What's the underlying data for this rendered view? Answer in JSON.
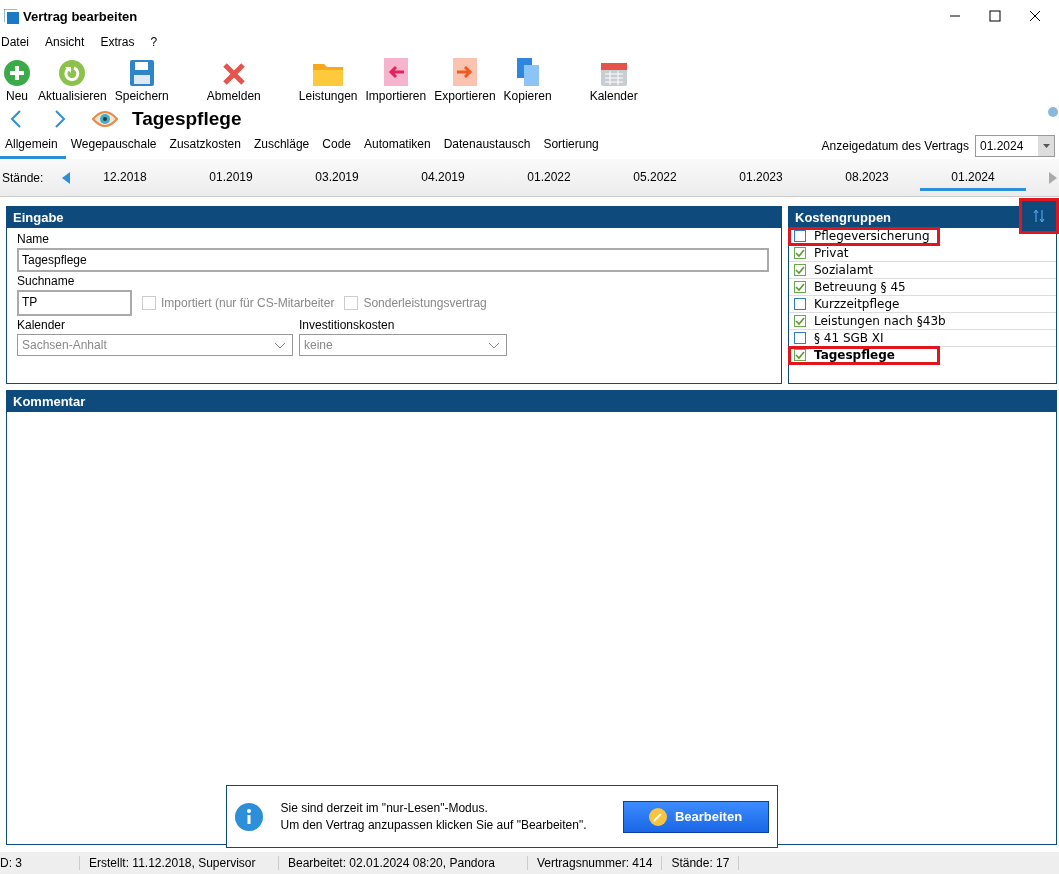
{
  "window": {
    "title": "Vertrag bearbeiten"
  },
  "menu": [
    "Datei",
    "Ansicht",
    "Extras",
    "?"
  ],
  "toolbar": [
    {
      "label": "Neu",
      "kind": "new"
    },
    {
      "label": "Aktualisieren",
      "kind": "refresh"
    },
    {
      "label": "Speichern",
      "kind": "save"
    },
    {
      "label": "Abmelden",
      "kind": "logout"
    },
    {
      "label": "Leistungen",
      "kind": "folder"
    },
    {
      "label": "Importieren",
      "kind": "import"
    },
    {
      "label": "Exportieren",
      "kind": "export"
    },
    {
      "label": "Kopieren",
      "kind": "copy"
    },
    {
      "label": "Kalender",
      "kind": "calendar"
    }
  ],
  "header": {
    "title": "Tagespflege"
  },
  "tabs": [
    {
      "label": "Allgemein",
      "selected": true
    },
    {
      "label": "Wegepauschale",
      "selected": false
    },
    {
      "label": "Zusatzkosten",
      "selected": false
    },
    {
      "label": "Zuschläge",
      "selected": false
    },
    {
      "label": "Code",
      "selected": false
    },
    {
      "label": "Automatiken",
      "selected": false
    },
    {
      "label": "Datenaustausch",
      "selected": false
    },
    {
      "label": "Sortierung",
      "selected": false
    }
  ],
  "display_date": {
    "label": "Anzeigedatum des Vertrags",
    "value": "01.2024"
  },
  "versions": {
    "label": "Stände:",
    "items": [
      {
        "label": "12.2018",
        "selected": false
      },
      {
        "label": "01.2019",
        "selected": false
      },
      {
        "label": "03.2019",
        "selected": false
      },
      {
        "label": "04.2019",
        "selected": false
      },
      {
        "label": "01.2022",
        "selected": false
      },
      {
        "label": "05.2022",
        "selected": false
      },
      {
        "label": "01.2023",
        "selected": false
      },
      {
        "label": "08.2023",
        "selected": false
      },
      {
        "label": "01.2024",
        "selected": true
      }
    ]
  },
  "input_panel": {
    "title": "Eingabe",
    "name_label": "Name",
    "name_value": "Tagespflege",
    "search_label": "Suchname",
    "search_value": "TP",
    "checkboxes": [
      {
        "label": "Importiert (nur für CS-Mitarbeiter",
        "checked": false,
        "disabled": true
      },
      {
        "label": "Sonderleistungsvertrag",
        "checked": false,
        "disabled": true
      }
    ],
    "calendar_label": "Kalender",
    "calendar_value": "Sachsen-Anhalt",
    "invest_label": "Investitionskosten",
    "invest_value": "keine"
  },
  "cost_groups": {
    "title": "Kostengruppen",
    "sort_highlighted": true,
    "items": [
      {
        "label": "Pflegeversicherung",
        "checked": false,
        "bold": false,
        "highlighted": true
      },
      {
        "label": "Privat",
        "checked": true,
        "bold": false,
        "highlighted": false
      },
      {
        "label": "Sozialamt",
        "checked": true,
        "bold": false,
        "highlighted": false
      },
      {
        "label": "Betreuung § 45",
        "checked": true,
        "bold": false,
        "highlighted": false
      },
      {
        "label": "Kurzzeitpflege",
        "checked": false,
        "bold": false,
        "highlighted": false
      },
      {
        "label": "Leistungen nach §43b",
        "checked": true,
        "bold": false,
        "highlighted": false
      },
      {
        "label": "§ 41 SGB XI",
        "checked": false,
        "bold": false,
        "highlighted": false
      },
      {
        "label": "Tagespflege",
        "checked": true,
        "bold": true,
        "highlighted": true
      }
    ]
  },
  "comment_panel": {
    "title": "Kommentar"
  },
  "notice": {
    "lines": [
      "Sie sind derzeit im \"nur-Lesen\"-Modus.",
      "Um den Vertrag anzupassen klicken Sie auf \"Bearbeiten\"."
    ],
    "button": "Bearbeiten"
  },
  "status_bar": [
    "D: 3",
    "Erstellt: 11.12.2018, Supervisor",
    "Bearbeitet: 02.01.2024 08:20, Pandora",
    "Vertragsnummer: 414",
    "Stände: 17"
  ]
}
